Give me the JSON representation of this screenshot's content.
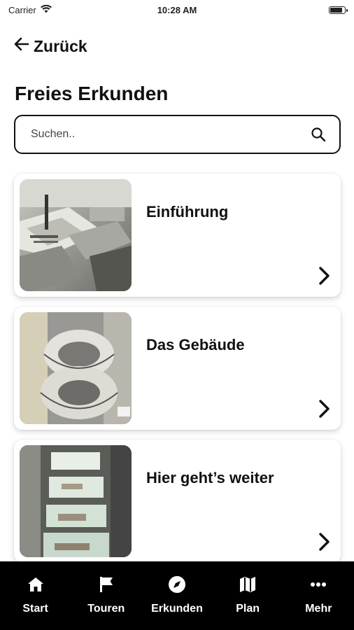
{
  "status_bar": {
    "carrier": "Carrier",
    "time": "10:28 AM"
  },
  "header": {
    "back_label": "Zurück",
    "title": "Freies Erkunden"
  },
  "search": {
    "placeholder": "Suchen.."
  },
  "cards": [
    {
      "title": "Einführung",
      "image": "historical-aerial-photo"
    },
    {
      "title": "Das Gebäude",
      "image": "spiral-staircase-photo"
    },
    {
      "title": "Hier geht’s weiter",
      "image": "glass-floor-photo"
    }
  ],
  "tabs": [
    {
      "label": "Start",
      "icon": "home-icon"
    },
    {
      "label": "Touren",
      "icon": "flag-icon"
    },
    {
      "label": "Erkunden",
      "icon": "compass-icon"
    },
    {
      "label": "Plan",
      "icon": "map-icon"
    },
    {
      "label": "Mehr",
      "icon": "more-icon"
    }
  ],
  "colors": {
    "tab_bar_bg": "#000000",
    "text": "#111111",
    "card_bg": "#ffffff"
  }
}
